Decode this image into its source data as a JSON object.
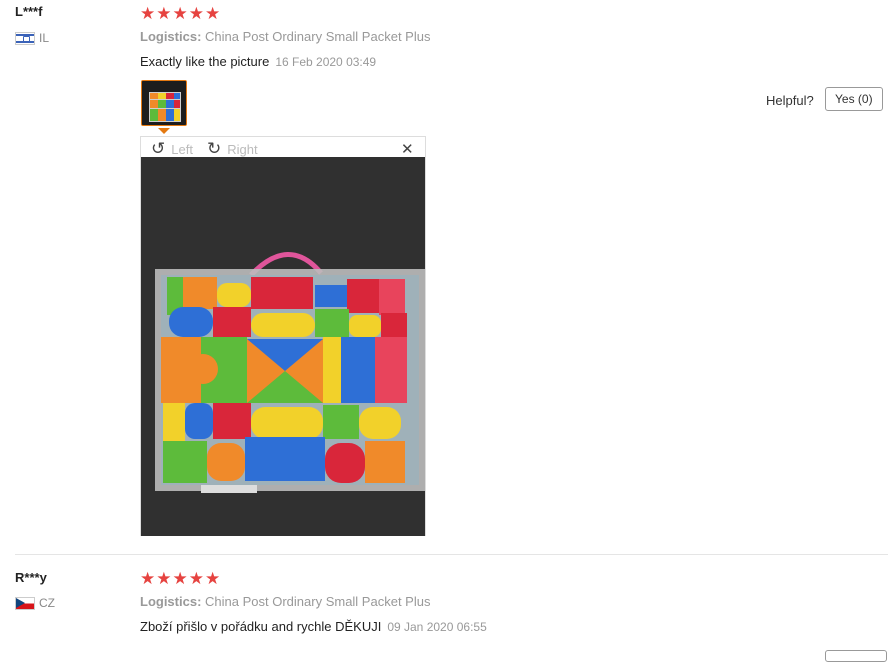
{
  "reviews": [
    {
      "user": "L***f",
      "country": "IL",
      "stars": "★★★★★",
      "logistics_label": "Logistics:",
      "logistics_value": "China Post Ordinary Small Packet Plus",
      "text": "Exactly like the picture",
      "date": "16 Feb 2020 03:49",
      "helpful_label": "Helpful?",
      "yes_label": "Yes (0)",
      "viewer": {
        "rotate_left": "Left",
        "rotate_right": "Right",
        "close": "✕"
      }
    },
    {
      "user": "R***y",
      "country": "CZ",
      "stars": "★★★★★",
      "logistics_label": "Logistics:",
      "logistics_value": "China Post Ordinary Small Packet Plus",
      "text": "Zboží přišlo v pořádku and rychle DĚKUJI",
      "date": "09 Jan 2020 06:55"
    }
  ],
  "colors": {
    "star": "#e64340",
    "thumb_border": "#e47911"
  }
}
